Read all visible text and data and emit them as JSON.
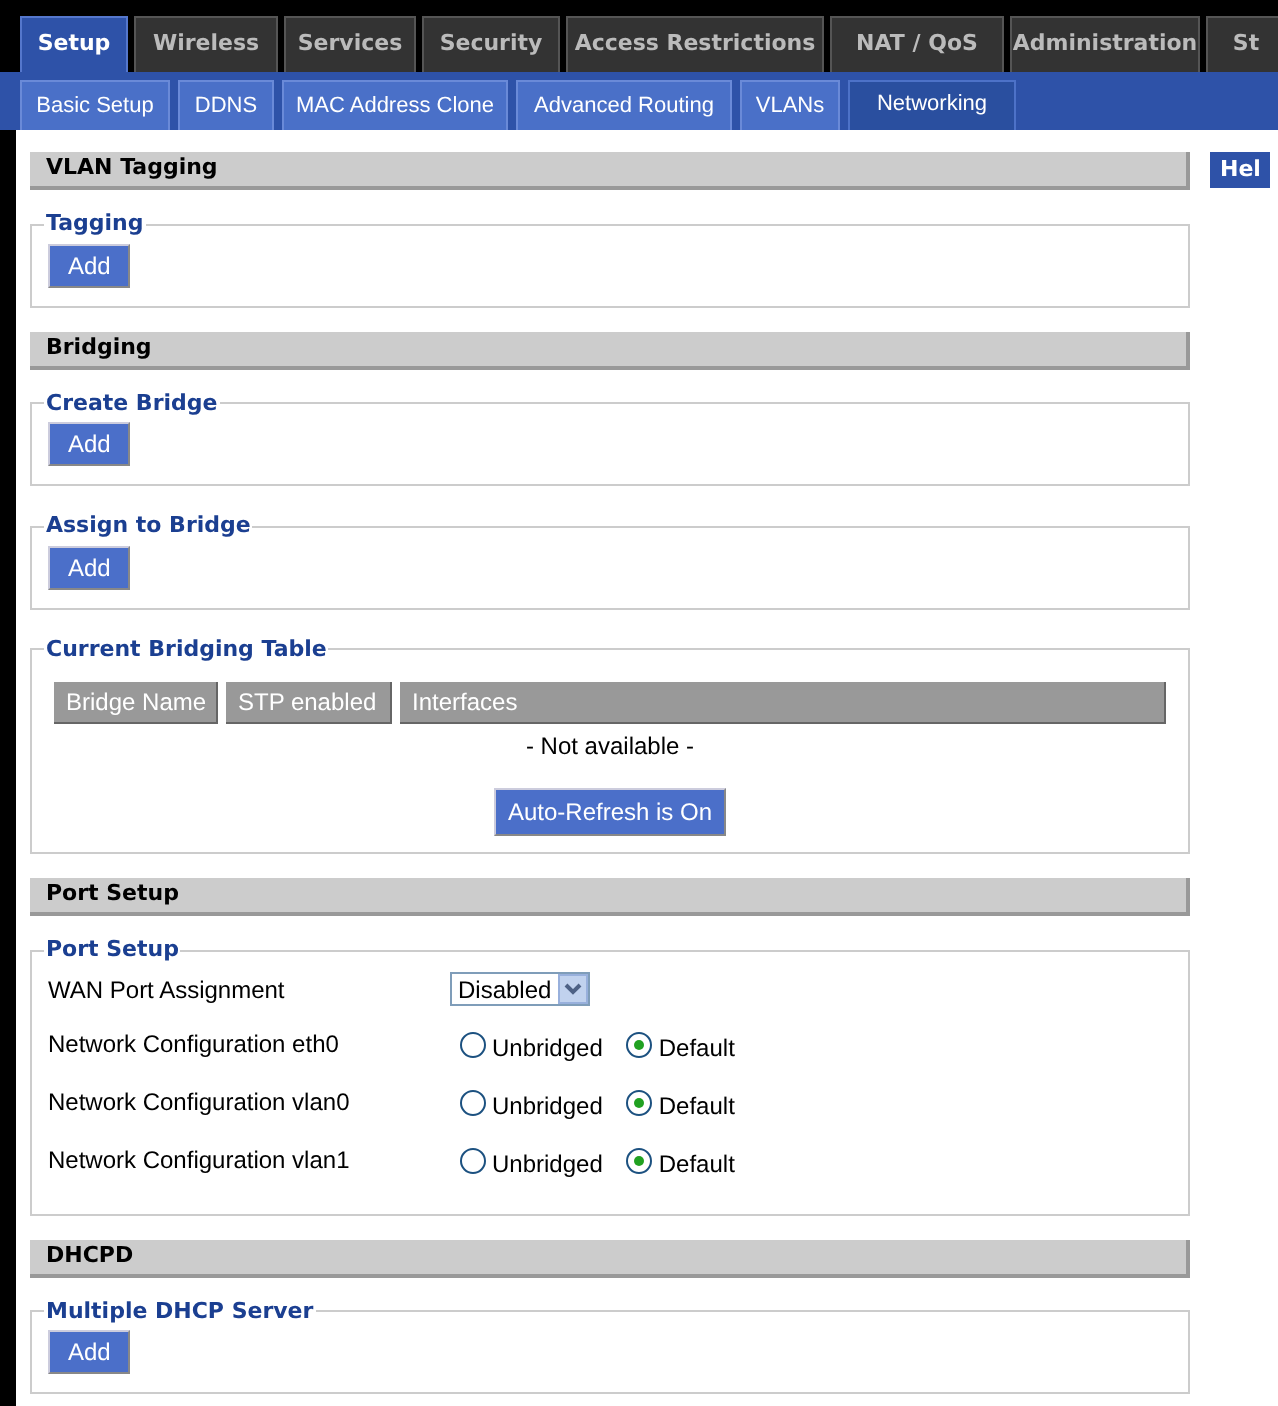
{
  "top_tabs": [
    {
      "label": "Setup",
      "selected": true
    },
    {
      "label": "Wireless",
      "selected": false
    },
    {
      "label": "Services",
      "selected": false
    },
    {
      "label": "Security",
      "selected": false
    },
    {
      "label": "Access Restrictions",
      "selected": false
    },
    {
      "label": "NAT / QoS",
      "selected": false
    },
    {
      "label": "Administration",
      "selected": false
    },
    {
      "label": "St",
      "selected": false
    }
  ],
  "sub_tabs": [
    {
      "label": "Basic Setup",
      "selected": false
    },
    {
      "label": "DDNS",
      "selected": false
    },
    {
      "label": "MAC Address Clone",
      "selected": false
    },
    {
      "label": "Advanced Routing",
      "selected": false
    },
    {
      "label": "VLANs",
      "selected": false
    },
    {
      "label": "Networking",
      "selected": true
    }
  ],
  "help": {
    "label": "Hel"
  },
  "sections": [
    {
      "title": "VLAN Tagging",
      "groups": [
        {
          "kind": "add",
          "legend": "Tagging",
          "button": "Add"
        }
      ]
    },
    {
      "title": "Bridging",
      "groups": [
        {
          "kind": "add",
          "legend": "Create Bridge",
          "button": "Add"
        },
        {
          "kind": "add",
          "legend": "Assign to Bridge",
          "button": "Add"
        },
        {
          "kind": "table",
          "legend": "Current Bridging Table",
          "columns": [
            "Bridge Name",
            "STP enabled",
            "Interfaces"
          ],
          "empty": "- Not available -",
          "button": "Auto-Refresh is On"
        }
      ]
    },
    {
      "title": "Port Setup",
      "groups": [
        {
          "kind": "ports",
          "legend": "Port Setup",
          "select": {
            "label": "WAN Port Assignment",
            "value": "Disabled"
          },
          "rows": [
            {
              "label": "Network Configuration eth0",
              "options": [
                {
                  "label": "Unbridged",
                  "selected": false
                },
                {
                  "label": "Default",
                  "selected": true
                }
              ]
            },
            {
              "label": "Network Configuration vlan0",
              "options": [
                {
                  "label": "Unbridged",
                  "selected": false
                },
                {
                  "label": "Default",
                  "selected": true
                }
              ]
            },
            {
              "label": "Network Configuration vlan1",
              "options": [
                {
                  "label": "Unbridged",
                  "selected": false
                },
                {
                  "label": "Default",
                  "selected": true
                }
              ]
            }
          ]
        }
      ]
    },
    {
      "title": "DHCPD",
      "groups": [
        {
          "kind": "add",
          "legend": "Multiple DHCP Server",
          "button": "Add"
        }
      ]
    }
  ]
}
